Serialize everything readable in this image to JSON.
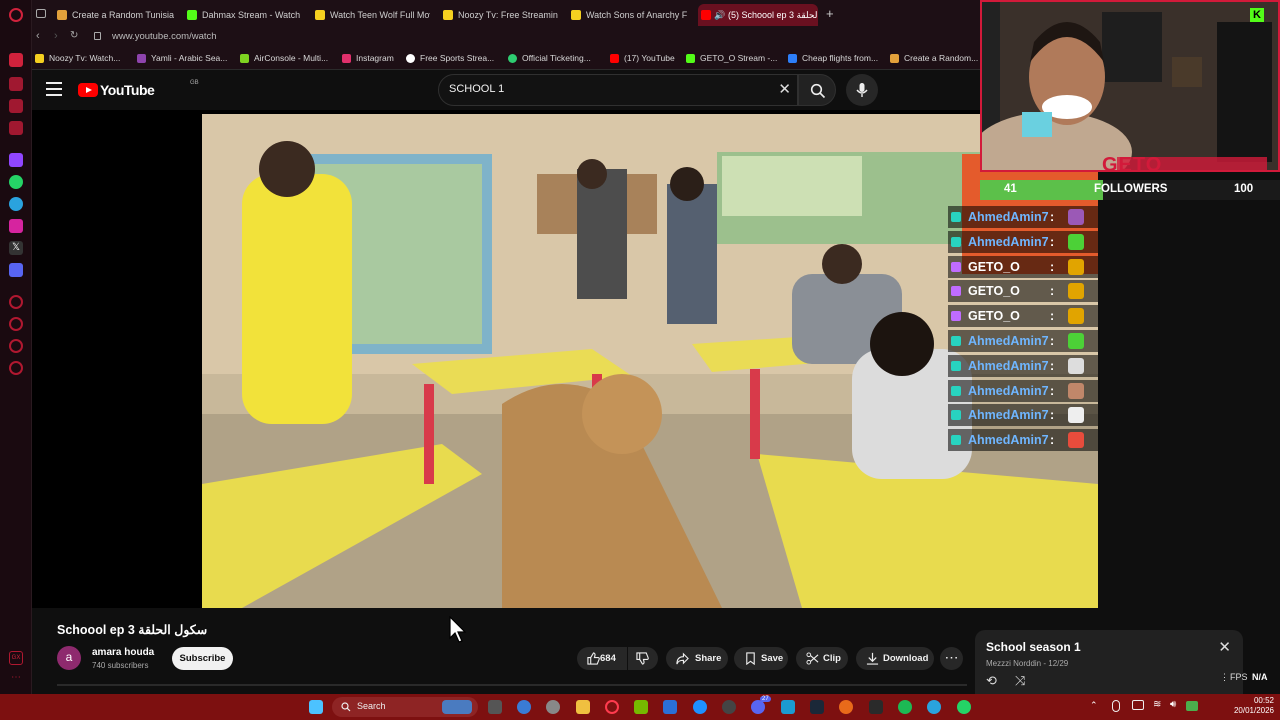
{
  "browser": {
    "tabs": [
      {
        "label": "Create a Random Tunisian",
        "color": "#e2a13b"
      },
      {
        "label": "Dahmax Stream - Watch",
        "color": "#53fc18"
      },
      {
        "label": "Watch Teen Wolf Full Mov",
        "color": "#f5d020"
      },
      {
        "label": "Noozy Tv: Free Streaming",
        "color": "#f5d020"
      },
      {
        "label": "Watch Sons of Anarchy F",
        "color": "#f5d020"
      },
      {
        "label": "(5) Schoool ep 3 الحلقة",
        "color": "#ff0000"
      }
    ],
    "add_tab": "+",
    "url": "www.youtube.com/watch",
    "bookmarks": [
      {
        "label": "Noozy Tv: Watch...",
        "color": "#f5d020"
      },
      {
        "label": "Yamli - Arabic Sea...",
        "color": "#8e44ad"
      },
      {
        "label": "AirConsole - Multi...",
        "color": "#7ed321"
      },
      {
        "label": "Instagram",
        "color": "#e1306c"
      },
      {
        "label": "Free Sports Strea...",
        "color": "#ffffff"
      },
      {
        "label": "Official Ticketing...",
        "color": "#2ecc71"
      },
      {
        "label": "(17) YouTube",
        "color": "#ff0000"
      },
      {
        "label": "GETO_O Stream -...",
        "color": "#53fc18"
      },
      {
        "label": "Cheap flights from...",
        "color": "#2d7ff9"
      },
      {
        "label": "Create a Random...",
        "color": "#e2a13b"
      }
    ]
  },
  "youtube": {
    "logo": "YouTube",
    "region": "GB",
    "search_value": "SCHOOL 1",
    "video_title": "Schoool ep 3 سكول الحلقة",
    "channel": {
      "avatar_letter": "a",
      "name": "amara houda",
      "subscribers": "740 subscribers"
    },
    "subscribe": "Subscribe",
    "likes": "684",
    "actions": {
      "share": "Share",
      "save": "Save",
      "clip": "Clip",
      "download": "Download"
    },
    "more": "⋯"
  },
  "stream_overlay": {
    "brand": "GETO",
    "kick_badge": "K",
    "followers_current": "41",
    "followers_label": "FOLLOWERS",
    "followers_goal": "100",
    "followers_progress": 0.41,
    "chat": [
      {
        "user": "AhmedAmin7",
        "color": "#6fb6ff",
        "badge": "#28d3c0",
        "emote": "#9b59b6"
      },
      {
        "user": "AhmedAmin7",
        "color": "#6fb6ff",
        "badge": "#28d3c0",
        "emote": "#4cd137"
      },
      {
        "user": "GETO_O",
        "color": "#ffffff",
        "badge": "#c06cff",
        "emote": "#e1a400"
      },
      {
        "user": "GETO_O",
        "color": "#ffffff",
        "badge": "#c06cff",
        "emote": "#e1a400"
      },
      {
        "user": "GETO_O",
        "color": "#ffffff",
        "badge": "#c06cff",
        "emote": "#e1a400"
      },
      {
        "user": "AhmedAmin7",
        "color": "#6fb6ff",
        "badge": "#28d3c0",
        "emote": "#4cd137"
      },
      {
        "user": "AhmedAmin7",
        "color": "#6fb6ff",
        "badge": "#28d3c0",
        "emote": "#dddddd"
      },
      {
        "user": "AhmedAmin7",
        "color": "#6fb6ff",
        "badge": "#28d3c0",
        "emote": "#c0876a"
      },
      {
        "user": "AhmedAmin7",
        "color": "#6fb6ff",
        "badge": "#28d3c0",
        "emote": "#eeeeee"
      },
      {
        "user": "AhmedAmin7",
        "color": "#6fb6ff",
        "badge": "#28d3c0",
        "emote": "#e74c3c"
      }
    ]
  },
  "playlist": {
    "title": "School season 1",
    "subtitle": "Mezzzi Norddin - 12/29"
  },
  "fps": {
    "label": "FPS",
    "value": "N/A"
  },
  "taskbar": {
    "search": "Search",
    "time": "00:52",
    "date": "20/01/2026",
    "badge_count": "27"
  }
}
